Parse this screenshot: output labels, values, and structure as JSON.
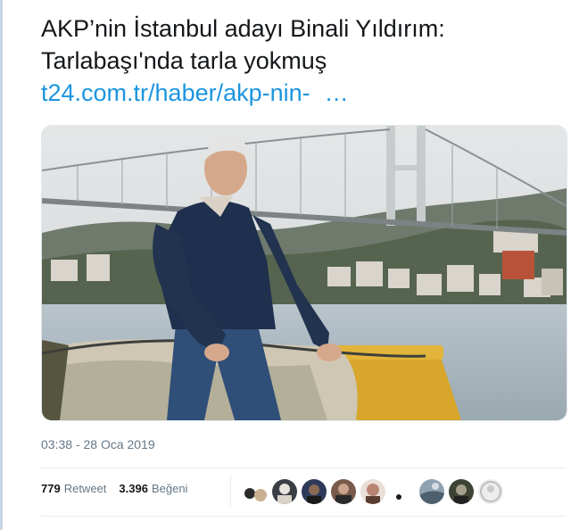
{
  "tweet": {
    "line1": "AKP’nin İstanbul adayı Binali Yıldırım:",
    "line2": "Tarlabaşı'nda tarla yokmuş",
    "link": "t24.com.tr/haber/akp-nin-",
    "ellipsis": "…"
  },
  "media": {
    "description_icon": "photo-icon"
  },
  "meta": {
    "timestamp": "03:38 - 28 Oca 2019"
  },
  "stats": {
    "retweet_count": "779",
    "retweet_label": "Retweet",
    "like_count": "3.396",
    "like_label": "Beğeni"
  },
  "colors": {
    "link": "#1b95e0",
    "muted": "#657786",
    "divider": "#e6ecf0"
  },
  "likers": [
    "avatar-1",
    "avatar-2",
    "avatar-3",
    "avatar-4",
    "avatar-5",
    "avatar-6",
    "avatar-7",
    "avatar-8",
    "avatar-9",
    "avatar-10"
  ]
}
